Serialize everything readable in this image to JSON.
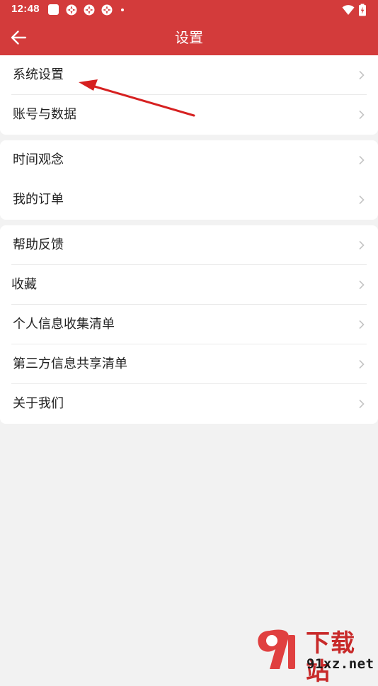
{
  "status_bar": {
    "time": "12:48",
    "icons": [
      "notification-square-icon",
      "app-flower-icon",
      "app-flower-icon",
      "app-flower-icon",
      "dot-icon",
      "wifi-icon",
      "battery-icon"
    ]
  },
  "header": {
    "title": "设置",
    "back_icon": "back-arrow-icon",
    "background_color": "#d33b3b"
  },
  "groups": [
    {
      "items": [
        {
          "label": "系统设置"
        },
        {
          "label": "账号与数据"
        }
      ]
    },
    {
      "items": [
        {
          "label": "时间观念"
        },
        {
          "label": "我的订单"
        }
      ]
    },
    {
      "items": [
        {
          "label": "帮助反馈"
        },
        {
          "label": "收藏"
        },
        {
          "label": "个人信息收集清单"
        },
        {
          "label": "第三方信息共享清单"
        },
        {
          "label": "关于我们"
        }
      ]
    }
  ],
  "row_chevron_icon": "chevron-right-icon",
  "annotation": {
    "color": "#d62020"
  },
  "watermark": {
    "brand": "下载站",
    "site": "91xz.net",
    "logo_text": "91",
    "color": "#c82a2a"
  }
}
